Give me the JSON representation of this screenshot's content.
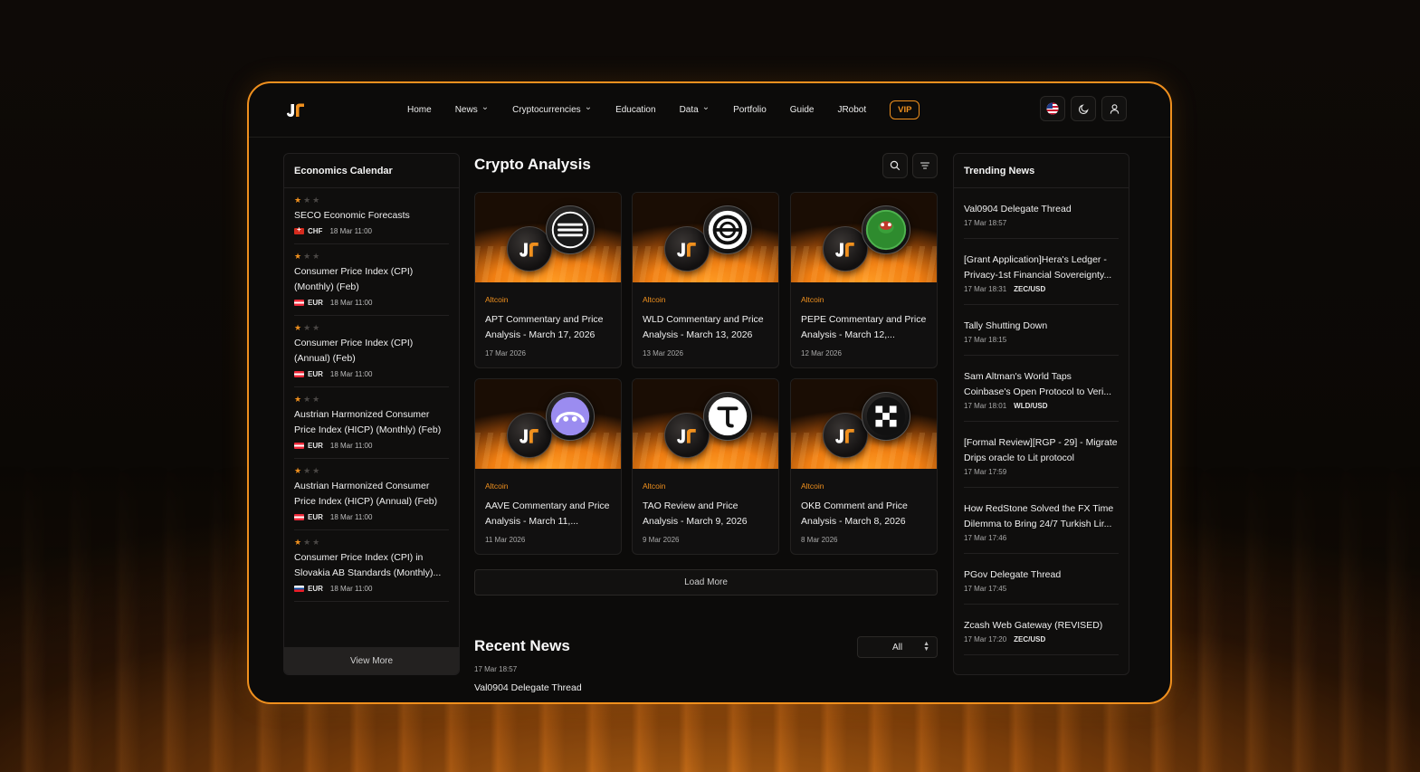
{
  "colors": {
    "accent": "#f0901e",
    "background": "#0c0b0a",
    "panel": "#0f0e0d"
  },
  "header": {
    "nav": [
      {
        "label": "Home",
        "dropdown": false
      },
      {
        "label": "News",
        "dropdown": true
      },
      {
        "label": "Cryptocurrencies",
        "dropdown": true
      },
      {
        "label": "Education",
        "dropdown": false
      },
      {
        "label": "Data",
        "dropdown": true
      },
      {
        "label": "Portfolio",
        "dropdown": false
      },
      {
        "label": "Guide",
        "dropdown": false
      },
      {
        "label": "JRobot",
        "dropdown": false
      }
    ],
    "vip_label": "VIP",
    "icons": [
      "us-flag-icon",
      "moon-icon",
      "user-icon"
    ]
  },
  "economics": {
    "title": "Economics Calendar",
    "items": [
      {
        "stars": 1,
        "title": "SECO Economic Forecasts",
        "flag": "ch",
        "currency": "CHF",
        "time": "18 Mar 11:00"
      },
      {
        "stars": 1,
        "title": "Consumer Price Index (CPI) (Monthly) (Feb)",
        "flag": "at",
        "currency": "EUR",
        "time": "18 Mar 11:00"
      },
      {
        "stars": 1,
        "title": "Consumer Price Index (CPI) (Annual) (Feb)",
        "flag": "at",
        "currency": "EUR",
        "time": "18 Mar 11:00"
      },
      {
        "stars": 1,
        "title": "Austrian Harmonized Consumer Price Index (HICP) (Monthly) (Feb)",
        "flag": "at",
        "currency": "EUR",
        "time": "18 Mar 11:00"
      },
      {
        "stars": 1,
        "title": "Austrian Harmonized Consumer Price Index (HICP) (Annual) (Feb)",
        "flag": "at",
        "currency": "EUR",
        "time": "18 Mar 11:00"
      },
      {
        "stars": 1,
        "title": "Consumer Price Index (CPI) in Slovakia AB Standards (Monthly)...",
        "flag": "sk",
        "currency": "EUR",
        "time": "18 Mar 11:00"
      }
    ],
    "view_more": "View More"
  },
  "analysis": {
    "title": "Crypto Analysis",
    "cards": [
      {
        "category": "Altcoin",
        "title": "APT Commentary and Price Analysis - March 17, 2026",
        "date": "17 Mar 2026",
        "token": "aptos"
      },
      {
        "category": "Altcoin",
        "title": "WLD Commentary and Price Analysis - March 13, 2026",
        "date": "13 Mar 2026",
        "token": "worldcoin"
      },
      {
        "category": "Altcoin",
        "title": "PEPE Commentary and Price Analysis - March 12,...",
        "date": "12 Mar 2026",
        "token": "pepe"
      },
      {
        "category": "Altcoin",
        "title": "AAVE Commentary and Price Analysis - March 11,...",
        "date": "11 Mar 2026",
        "token": "aave"
      },
      {
        "category": "Altcoin",
        "title": "TAO Review and Price Analysis - March 9, 2026",
        "date": "9 Mar 2026",
        "token": "bittensor"
      },
      {
        "category": "Altcoin",
        "title": "OKB Comment and Price Analysis - March 8, 2026",
        "date": "8 Mar 2026",
        "token": "okb"
      }
    ],
    "load_more": "Load More"
  },
  "recent": {
    "title": "Recent News",
    "filter": "All",
    "first": {
      "time": "17 Mar 18:57",
      "title": "Val0904 Delegate Thread"
    }
  },
  "trending": {
    "title": "Trending News",
    "items": [
      {
        "title": "Val0904 Delegate Thread",
        "time": "17 Mar 18:57",
        "pair": ""
      },
      {
        "title": "[Grant Application]Hera's Ledger - Privacy-1st Financial Sovereignty...",
        "time": "17 Mar 18:31",
        "pair": "ZEC/USD"
      },
      {
        "title": "Tally Shutting Down",
        "time": "17 Mar 18:15",
        "pair": ""
      },
      {
        "title": "Sam Altman's World Taps Coinbase's Open Protocol to Veri...",
        "time": "17 Mar 18:01",
        "pair": "WLD/USD"
      },
      {
        "title": "[Formal Review][RGP - 29] - Migrate Drips oracle to Lit protocol",
        "time": "17 Mar 17:59",
        "pair": ""
      },
      {
        "title": "How RedStone Solved the FX Time Dilemma to Bring 24/7 Turkish Lir...",
        "time": "17 Mar 17:46",
        "pair": ""
      },
      {
        "title": "PGov Delegate Thread",
        "time": "17 Mar 17:45",
        "pair": ""
      },
      {
        "title": "Zcash Web Gateway (REVISED)",
        "time": "17 Mar 17:20",
        "pair": "ZEC/USD"
      }
    ]
  }
}
